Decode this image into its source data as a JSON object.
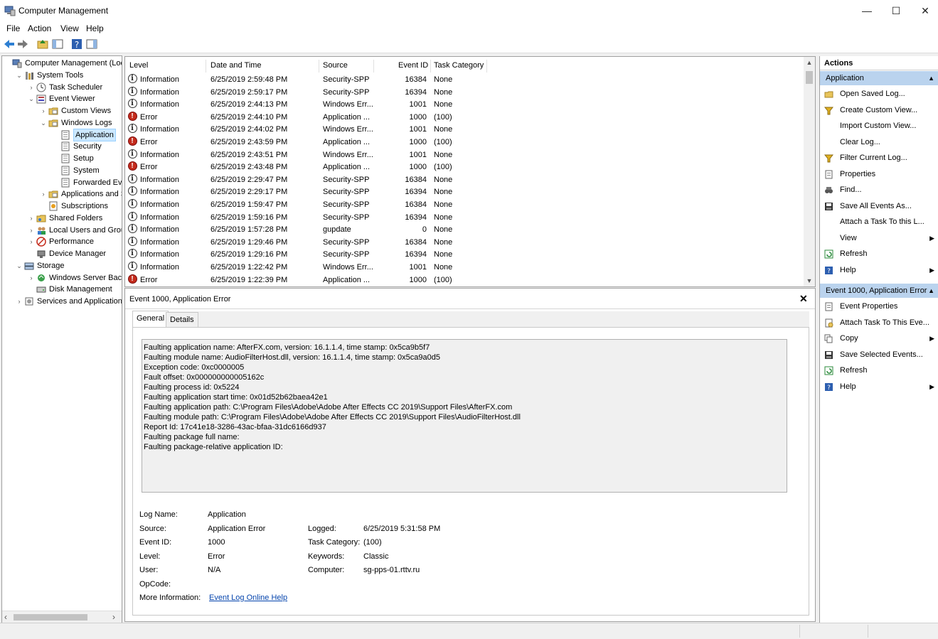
{
  "window": {
    "title": "Computer Management",
    "minimize": "—",
    "maximize": "☐",
    "close": "✕"
  },
  "menu": [
    "File",
    "Action",
    "View",
    "Help"
  ],
  "tree": [
    {
      "label": "Computer Management (Local",
      "indent": 0,
      "arrow": "",
      "icon": "computer-icon"
    },
    {
      "label": "System Tools",
      "indent": 1,
      "arrow": "⌄",
      "icon": "tools-icon"
    },
    {
      "label": "Task Scheduler",
      "indent": 2,
      "arrow": "›",
      "icon": "clock-icon"
    },
    {
      "label": "Event Viewer",
      "indent": 2,
      "arrow": "⌄",
      "icon": "event-viewer-icon"
    },
    {
      "label": "Custom Views",
      "indent": 3,
      "arrow": "›",
      "icon": "folder-icon"
    },
    {
      "label": "Windows Logs",
      "indent": 3,
      "arrow": "⌄",
      "icon": "folder-icon"
    },
    {
      "label": "Application",
      "indent": 4,
      "arrow": "",
      "icon": "log-icon",
      "selected": true
    },
    {
      "label": "Security",
      "indent": 4,
      "arrow": "",
      "icon": "log-icon"
    },
    {
      "label": "Setup",
      "indent": 4,
      "arrow": "",
      "icon": "log-icon"
    },
    {
      "label": "System",
      "indent": 4,
      "arrow": "",
      "icon": "log-icon"
    },
    {
      "label": "Forwarded Event",
      "indent": 4,
      "arrow": "",
      "icon": "log-icon"
    },
    {
      "label": "Applications and Se",
      "indent": 3,
      "arrow": "›",
      "icon": "folder-icon"
    },
    {
      "label": "Subscriptions",
      "indent": 3,
      "arrow": "",
      "icon": "subscriptions-icon"
    },
    {
      "label": "Shared Folders",
      "indent": 2,
      "arrow": "›",
      "icon": "shared-folder-icon"
    },
    {
      "label": "Local Users and Groups",
      "indent": 2,
      "arrow": "›",
      "icon": "users-icon"
    },
    {
      "label": "Performance",
      "indent": 2,
      "arrow": "›",
      "icon": "performance-icon"
    },
    {
      "label": "Device Manager",
      "indent": 2,
      "arrow": "",
      "icon": "device-manager-icon"
    },
    {
      "label": "Storage",
      "indent": 1,
      "arrow": "⌄",
      "icon": "storage-icon"
    },
    {
      "label": "Windows Server Backup",
      "indent": 2,
      "arrow": "›",
      "icon": "backup-icon"
    },
    {
      "label": "Disk Management",
      "indent": 2,
      "arrow": "",
      "icon": "disk-icon"
    },
    {
      "label": "Services and Applications",
      "indent": 1,
      "arrow": "›",
      "icon": "services-icon"
    }
  ],
  "events": {
    "columns": [
      "Level",
      "Date and Time",
      "Source",
      "Event ID",
      "Task Category"
    ],
    "rows": [
      {
        "level": "Information",
        "date": "6/25/2019 2:59:48 PM",
        "source": "Security-SPP",
        "id": "16384",
        "cat": "None"
      },
      {
        "level": "Information",
        "date": "6/25/2019 2:59:17 PM",
        "source": "Security-SPP",
        "id": "16394",
        "cat": "None"
      },
      {
        "level": "Information",
        "date": "6/25/2019 2:44:13 PM",
        "source": "Windows Err...",
        "id": "1001",
        "cat": "None"
      },
      {
        "level": "Error",
        "date": "6/25/2019 2:44:10 PM",
        "source": "Application ...",
        "id": "1000",
        "cat": "(100)"
      },
      {
        "level": "Information",
        "date": "6/25/2019 2:44:02 PM",
        "source": "Windows Err...",
        "id": "1001",
        "cat": "None"
      },
      {
        "level": "Error",
        "date": "6/25/2019 2:43:59 PM",
        "source": "Application ...",
        "id": "1000",
        "cat": "(100)"
      },
      {
        "level": "Information",
        "date": "6/25/2019 2:43:51 PM",
        "source": "Windows Err...",
        "id": "1001",
        "cat": "None"
      },
      {
        "level": "Error",
        "date": "6/25/2019 2:43:48 PM",
        "source": "Application ...",
        "id": "1000",
        "cat": "(100)"
      },
      {
        "level": "Information",
        "date": "6/25/2019 2:29:47 PM",
        "source": "Security-SPP",
        "id": "16384",
        "cat": "None"
      },
      {
        "level": "Information",
        "date": "6/25/2019 2:29:17 PM",
        "source": "Security-SPP",
        "id": "16394",
        "cat": "None"
      },
      {
        "level": "Information",
        "date": "6/25/2019 1:59:47 PM",
        "source": "Security-SPP",
        "id": "16384",
        "cat": "None"
      },
      {
        "level": "Information",
        "date": "6/25/2019 1:59:16 PM",
        "source": "Security-SPP",
        "id": "16394",
        "cat": "None"
      },
      {
        "level": "Information",
        "date": "6/25/2019 1:57:28 PM",
        "source": "gupdate",
        "id": "0",
        "cat": "None"
      },
      {
        "level": "Information",
        "date": "6/25/2019 1:29:46 PM",
        "source": "Security-SPP",
        "id": "16384",
        "cat": "None"
      },
      {
        "level": "Information",
        "date": "6/25/2019 1:29:16 PM",
        "source": "Security-SPP",
        "id": "16394",
        "cat": "None"
      },
      {
        "level": "Information",
        "date": "6/25/2019 1:22:42 PM",
        "source": "Windows Err...",
        "id": "1001",
        "cat": "None"
      },
      {
        "level": "Error",
        "date": "6/25/2019 1:22:39 PM",
        "source": "Application ...",
        "id": "1000",
        "cat": "(100)"
      }
    ]
  },
  "detail": {
    "title": "Event 1000, Application Error",
    "close": "✕",
    "tabs": [
      "General",
      "Details"
    ],
    "description": [
      "Faulting application name: AfterFX.com, version: 16.1.1.4, time stamp: 0x5ca9b5f7",
      "Faulting module name: AudioFilterHost.dll, version: 16.1.1.4, time stamp: 0x5ca9a0d5",
      "Exception code: 0xc0000005",
      "Fault offset: 0x000000000005162c",
      "Faulting process id: 0x5224",
      "Faulting application start time: 0x01d52b62baea42e1",
      "Faulting application path: C:\\Program Files\\Adobe\\Adobe After Effects CC 2019\\Support Files\\AfterFX.com",
      "Faulting module path: C:\\Program Files\\Adobe\\Adobe After Effects CC 2019\\Support Files\\AudioFilterHost.dll",
      "Report Id: 17c41e18-3286-43ac-bfaa-31dc6166d937",
      "Faulting package full name: ",
      "Faulting package-relative application ID: "
    ],
    "props": {
      "log_name_label": "Log Name:",
      "log_name": "Application",
      "source_label": "Source:",
      "source": "Application Error",
      "logged_label": "Logged:",
      "logged": "6/25/2019 5:31:58 PM",
      "event_id_label": "Event ID:",
      "event_id": "1000",
      "task_cat_label": "Task Category:",
      "task_cat": "(100)",
      "level_label": "Level:",
      "level": "Error",
      "keywords_label": "Keywords:",
      "keywords": "Classic",
      "user_label": "User:",
      "user": "N/A",
      "computer_label": "Computer:",
      "computer": "sg-pps-01.rttv.ru",
      "opcode_label": "OpCode:",
      "opcode": "",
      "more_info_label": "More Information:",
      "more_info_link": "Event Log Online Help"
    }
  },
  "actions": {
    "header": "Actions",
    "group1_title": "Application",
    "group1": [
      {
        "label": "Open Saved Log...",
        "icon": "open-folder-icon",
        "sub": false
      },
      {
        "label": "Create Custom View...",
        "icon": "filter-icon",
        "sub": false
      },
      {
        "label": "Import Custom View...",
        "icon": "",
        "sub": false
      },
      {
        "label": "Clear Log...",
        "icon": "",
        "sub": false
      },
      {
        "label": "Filter Current Log...",
        "icon": "filter-icon",
        "sub": false
      },
      {
        "label": "Properties",
        "icon": "properties-icon",
        "sub": false
      },
      {
        "label": "Find...",
        "icon": "binoculars-icon",
        "sub": false
      },
      {
        "label": "Save All Events As...",
        "icon": "save-icon",
        "sub": false
      },
      {
        "label": "Attach a Task To this L...",
        "icon": "",
        "sub": false
      },
      {
        "label": "View",
        "icon": "",
        "sub": true
      },
      {
        "label": "Refresh",
        "icon": "refresh-icon",
        "sub": false
      },
      {
        "label": "Help",
        "icon": "help-icon",
        "sub": true
      }
    ],
    "group2_title": "Event 1000, Application Error",
    "group2": [
      {
        "label": "Event Properties",
        "icon": "properties-icon",
        "sub": false
      },
      {
        "label": "Attach Task To This Eve...",
        "icon": "task-icon",
        "sub": false
      },
      {
        "label": "Copy",
        "icon": "copy-icon",
        "sub": true
      },
      {
        "label": "Save Selected Events...",
        "icon": "save-icon",
        "sub": false
      },
      {
        "label": "Refresh",
        "icon": "refresh-icon",
        "sub": false
      },
      {
        "label": "Help",
        "icon": "help-icon",
        "sub": true
      }
    ]
  },
  "colors": {
    "selection": "#cce8ff",
    "actions_header": "#bad3ee",
    "error": "#c42b1c",
    "link": "#0645ad"
  }
}
